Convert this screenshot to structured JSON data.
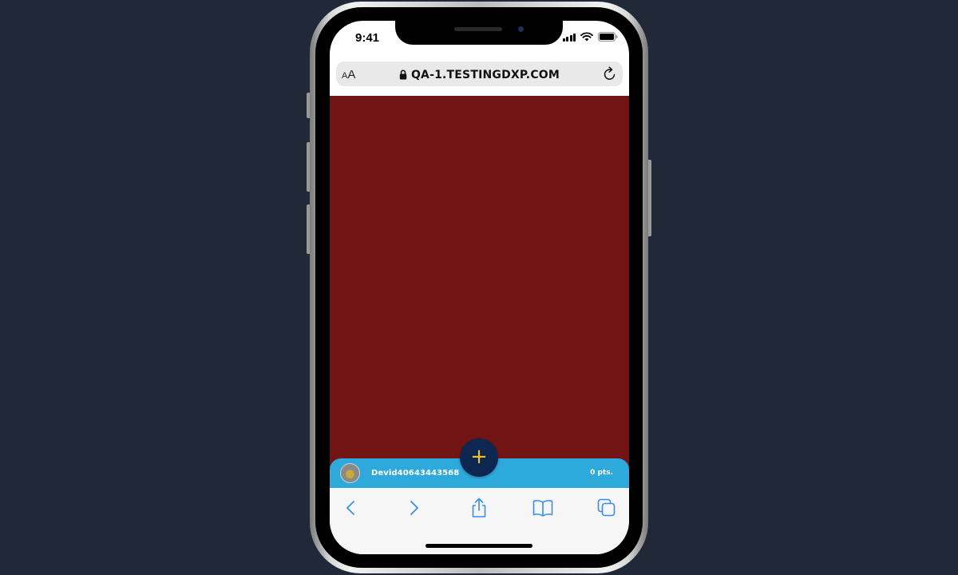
{
  "status_bar": {
    "time": "9:41"
  },
  "browser": {
    "text_size_label_small": "A",
    "text_size_label_large": "A",
    "url": "QA-1.TESTINGDXP.COM"
  },
  "player_bar": {
    "username": "Devid40643443568",
    "points": "0 pts."
  },
  "fab": {
    "label": "+"
  },
  "colors": {
    "background": "#212838",
    "content": "#731414",
    "player_bar": "#2ea9dc",
    "fab": "#0d2750",
    "fab_icon": "#f2c21a",
    "toolbar_icon": "#3a8ee6"
  },
  "toolbar": {
    "icons": [
      "back-icon",
      "forward-icon",
      "share-icon",
      "bookmarks-icon",
      "tabs-icon"
    ]
  }
}
